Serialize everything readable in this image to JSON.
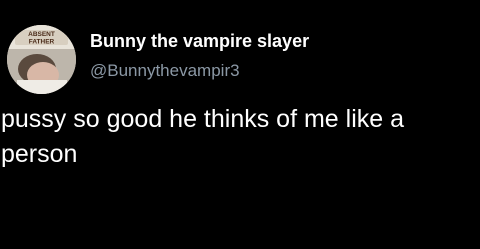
{
  "tweet": {
    "avatar": {
      "icon": "profile-photo-icon",
      "badge_line1": "ABSENT",
      "badge_line2": "FATHER"
    },
    "author": {
      "display_name": "Bunny the vampire slayer",
      "handle": "@Bunnythevampir3"
    },
    "text": "pussy so good he thinks of me like a person"
  },
  "colors": {
    "background": "#000000",
    "primary_text": "#ffffff",
    "secondary_text": "#8b98a5"
  }
}
